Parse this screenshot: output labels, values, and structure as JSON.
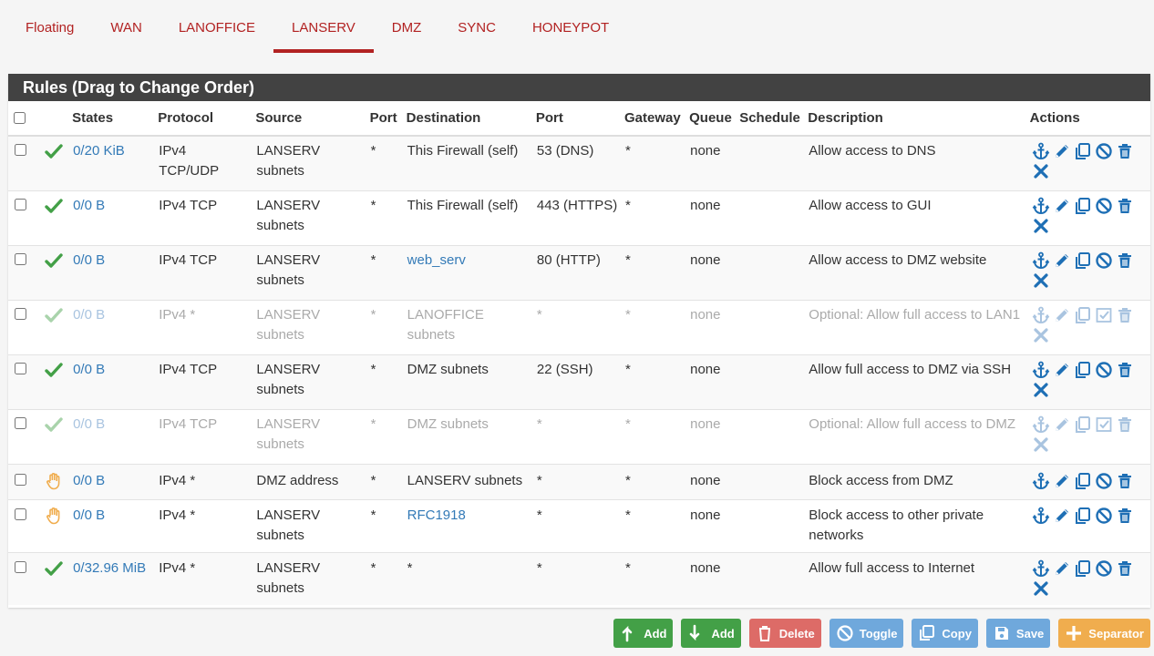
{
  "tabs": [
    {
      "label": "Floating",
      "active": false
    },
    {
      "label": "WAN",
      "active": false
    },
    {
      "label": "LANOFFICE",
      "active": false
    },
    {
      "label": "LANSERV",
      "active": true
    },
    {
      "label": "DMZ",
      "active": false
    },
    {
      "label": "SYNC",
      "active": false
    },
    {
      "label": "HONEYPOT",
      "active": false
    }
  ],
  "panel": {
    "title": "Rules (Drag to Change Order)"
  },
  "columns": {
    "states": "States",
    "protocol": "Protocol",
    "source": "Source",
    "port": "Port",
    "destination": "Destination",
    "dport": "Port",
    "gateway": "Gateway",
    "queue": "Queue",
    "schedule": "Schedule",
    "description": "Description",
    "actions": "Actions"
  },
  "rules": [
    {
      "status": "pass",
      "states": "0/20 KiB",
      "protocol": "IPv4 TCP/UDP",
      "source": "LANSERV subnets",
      "port": "*",
      "destination": "This Firewall (self)",
      "dest_link": false,
      "dport": "53 (DNS)",
      "gateway": "*",
      "queue": "none",
      "schedule": "",
      "description": "Allow access to DNS",
      "disabled": false,
      "row": "r1"
    },
    {
      "status": "pass",
      "states": "0/0 B",
      "protocol": "IPv4 TCP",
      "source": "LANSERV subnets",
      "port": "*",
      "destination": "This Firewall (self)",
      "dest_link": false,
      "dport": "443 (HTTPS)",
      "gateway": "*",
      "queue": "none",
      "schedule": "",
      "description": "Allow access to GUI",
      "disabled": false,
      "row": "r1"
    },
    {
      "status": "pass",
      "states": "0/0 B",
      "protocol": "IPv4 TCP",
      "source": "LANSERV subnets",
      "port": "*",
      "destination": "web_serv",
      "dest_link": true,
      "dport": "80 (HTTP)",
      "gateway": "*",
      "queue": "none",
      "schedule": "",
      "description": "Allow access to DMZ website",
      "disabled": false,
      "row": "r1"
    },
    {
      "status": "pass",
      "states": "0/0 B",
      "protocol": "IPv4 *",
      "source": "LANSERV subnets",
      "port": "*",
      "destination": "LANOFFICE subnets",
      "dest_link": false,
      "dport": "*",
      "gateway": "*",
      "queue": "none",
      "schedule": "",
      "description": "Optional: Allow full access to LAN1",
      "disabled": true,
      "row": "r1"
    },
    {
      "status": "pass",
      "states": "0/0 B",
      "protocol": "IPv4 TCP",
      "source": "LANSERV subnets",
      "port": "*",
      "destination": "DMZ subnets",
      "dest_link": false,
      "dport": "22 (SSH)",
      "gateway": "*",
      "queue": "none",
      "schedule": "",
      "description": "Allow full access to DMZ via SSH",
      "disabled": false,
      "row": "r1"
    },
    {
      "status": "pass",
      "states": "0/0 B",
      "protocol": "IPv4 TCP",
      "source": "LANSERV subnets",
      "port": "*",
      "destination": "DMZ subnets",
      "dest_link": false,
      "dport": "*",
      "gateway": "*",
      "queue": "none",
      "schedule": "",
      "description": "Optional: Allow full access to DMZ",
      "disabled": true,
      "row": "r1"
    },
    {
      "status": "block",
      "states": "0/0 B",
      "protocol": "IPv4 *",
      "source": "DMZ address",
      "port": "*",
      "destination": "LANSERV subnets",
      "dest_link": false,
      "dport": "*",
      "gateway": "*",
      "queue": "none",
      "schedule": "",
      "description": "Block access from DMZ",
      "disabled": false,
      "row": "r2"
    },
    {
      "status": "block",
      "states": "0/0 B",
      "protocol": "IPv4 *",
      "source": "LANSERV subnets",
      "port": "*",
      "destination": "RFC1918",
      "dest_link": true,
      "dport": "*",
      "gateway": "*",
      "queue": "none",
      "schedule": "",
      "description": "Block access to other private networks",
      "disabled": false,
      "row": "r3"
    },
    {
      "status": "pass",
      "states": "0/32.96 MiB",
      "protocol": "IPv4 *",
      "source": "LANSERV subnets",
      "port": "*",
      "destination": "*",
      "dest_link": false,
      "dport": "*",
      "gateway": "*",
      "queue": "none",
      "schedule": "",
      "description": "Allow full access to Internet",
      "disabled": false,
      "row": "r3"
    }
  ],
  "buttons": {
    "add_top": "Add",
    "add_bottom": "Add",
    "delete": "Delete",
    "toggle": "Toggle",
    "copy": "Copy",
    "save": "Save",
    "separator": "Separator"
  },
  "colors": {
    "accent": "#b22222",
    "link": "#337ab7",
    "pass": "#43a047",
    "block": "#f0ad4e",
    "action_icon": "#1e6fb5",
    "header": "#424242"
  },
  "icons": {
    "pass": "check-icon",
    "block": "hand-icon",
    "anchor": "anchor-icon",
    "edit": "pencil-icon",
    "copy": "copy-icon",
    "disable": "ban-icon",
    "enable": "checkbox-icon",
    "delete": "trash-icon",
    "kill_states": "x-icon"
  }
}
